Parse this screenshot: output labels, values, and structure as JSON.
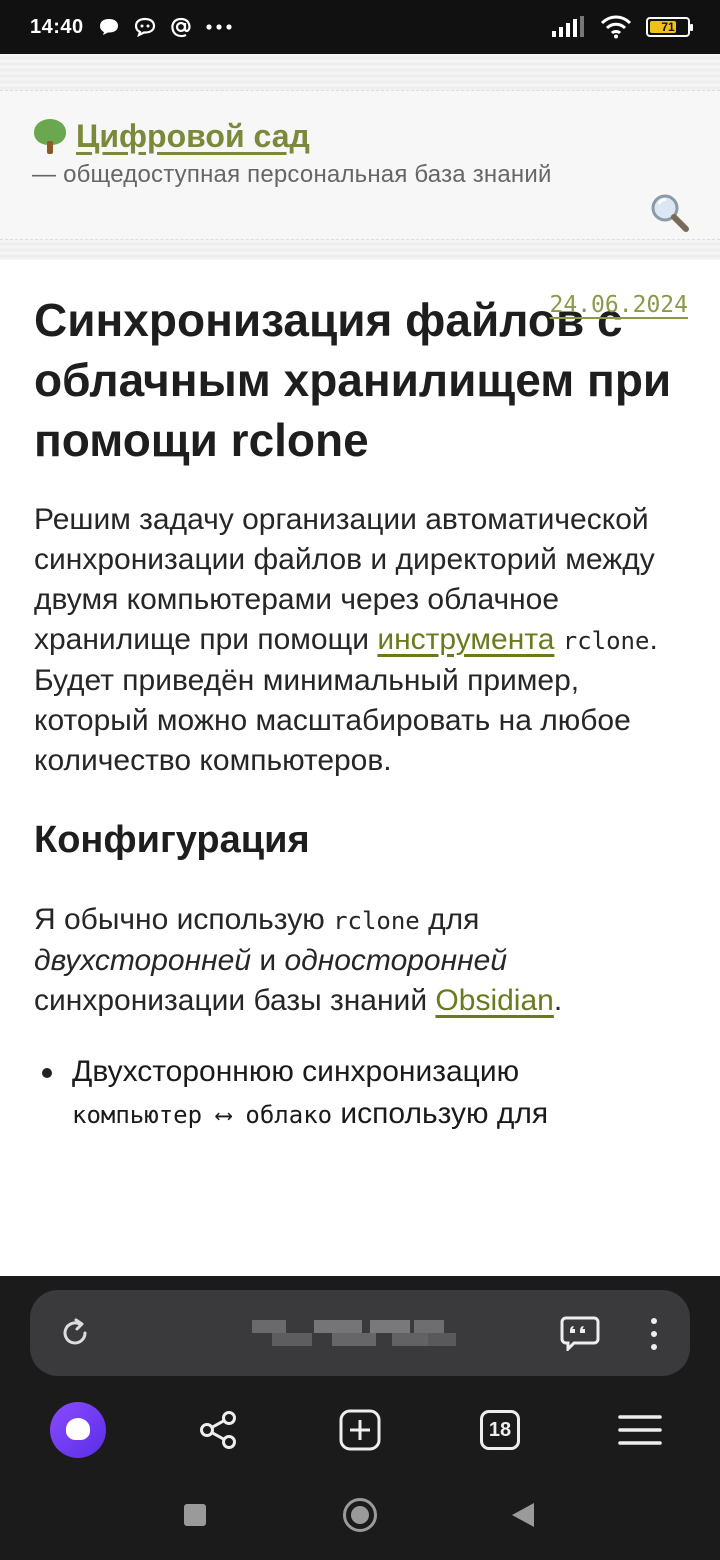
{
  "status": {
    "time": "14:40",
    "battery": "71",
    "battery_level": 0.71
  },
  "site": {
    "title": "Цифровой сад",
    "subtitle": "— общедоступная персональная база знаний",
    "icons": [
      "tree-icon",
      "search-icon"
    ]
  },
  "article": {
    "date": "24.06.2024",
    "title": "Синхронизация файлов с облачным хранилищем при помощи rclone",
    "intro": {
      "p1": "Решим задачу организации автоматической синхронизации файлов и директорий между двумя компьютерами через облачное хранилище при помощи ",
      "link": "инструмента",
      "p2": " ",
      "code": "rclone",
      "p3": ". Будет приведён минимальный пример, который можно масштабировать на любое количество компьютеров."
    },
    "section_title": "Конфигурация",
    "config": {
      "t1": "Я обычно использую ",
      "code": "rclone",
      "t2": " для ",
      "em1": "двухсторонней",
      "t3": " и ",
      "em2": "односторонней",
      "t4": " синхронизации базы знаний ",
      "link": "Obsidian",
      "t5": "."
    },
    "bullet": {
      "t1": "Двухстороннюю синхронизацию",
      "code": "компьютер ⟷ облако",
      "t2": " использую для"
    }
  },
  "browser": {
    "url": "",
    "tabs_count": "18",
    "icons": [
      "reload-icon",
      "quote-icon",
      "more-icon",
      "alice-icon",
      "share-icon",
      "new-tab-icon",
      "tabs-icon",
      "menu-icon"
    ]
  }
}
